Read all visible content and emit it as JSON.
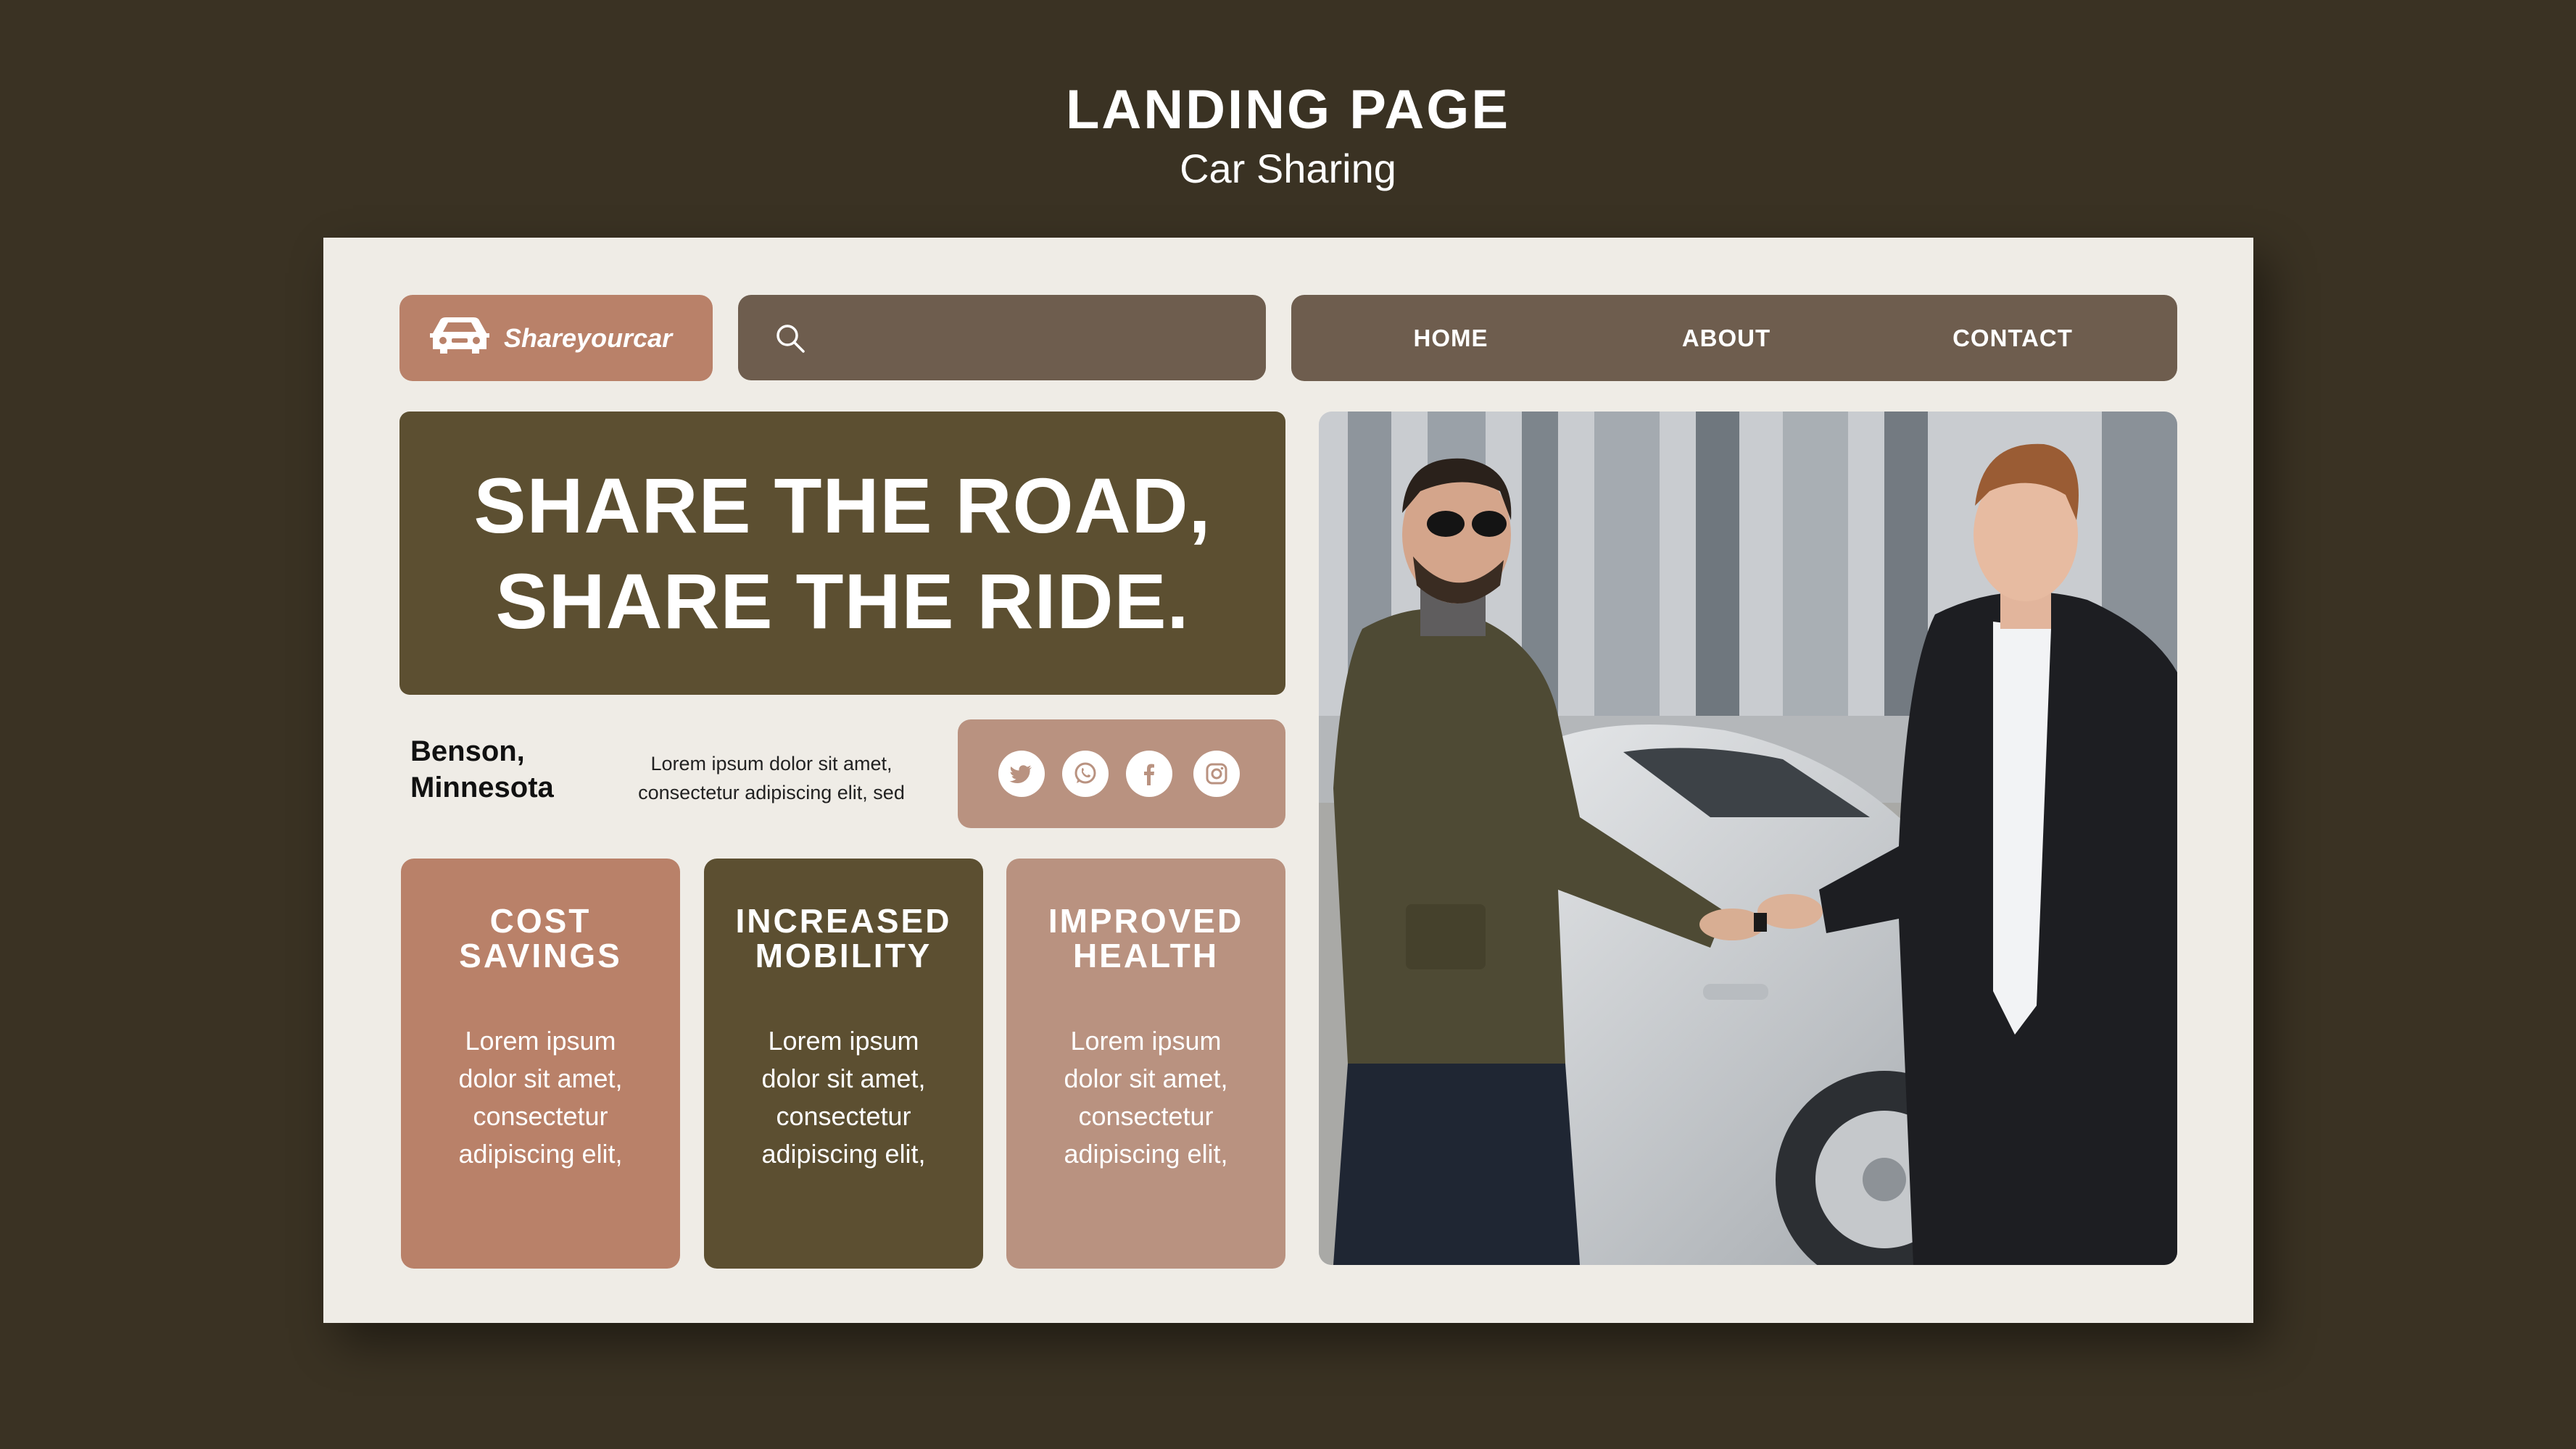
{
  "header": {
    "title": "LANDING PAGE",
    "subtitle": "Car Sharing"
  },
  "logo": {
    "text": "Shareyourcar",
    "icon": "car-icon"
  },
  "search": {
    "icon": "search-icon",
    "placeholder": ""
  },
  "nav": {
    "items": [
      {
        "label": "HOME"
      },
      {
        "label": "ABOUT"
      },
      {
        "label": "CONTACT"
      }
    ]
  },
  "hero": {
    "line1": "SHARE THE ROAD,",
    "line2": "SHARE THE RIDE."
  },
  "location": {
    "line1": "Benson,",
    "line2": "Minnesota"
  },
  "blurb": "Lorem ipsum dolor sit amet, consectetur adipiscing elit, sed",
  "social": {
    "icons": [
      "twitter-icon",
      "whatsapp-icon",
      "facebook-icon",
      "instagram-icon"
    ]
  },
  "cards": [
    {
      "title": "COST SAVINGS",
      "body": "Lorem ipsum dolor sit amet, consectetur adipiscing elit,"
    },
    {
      "title": "INCREASED MOBILITY",
      "body": "Lorem ipsum dolor sit amet, consectetur adipiscing elit,"
    },
    {
      "title": "IMPROVED HEALTH",
      "body": "Lorem ipsum dolor sit amet, consectetur adipiscing elit,"
    }
  ],
  "colors": {
    "background": "#3a3223",
    "board": "#efece6",
    "terracotta": "#b98169",
    "olive": "#5c4f31",
    "taupe": "#6e5d4e",
    "dusty_rose": "#b99280"
  }
}
